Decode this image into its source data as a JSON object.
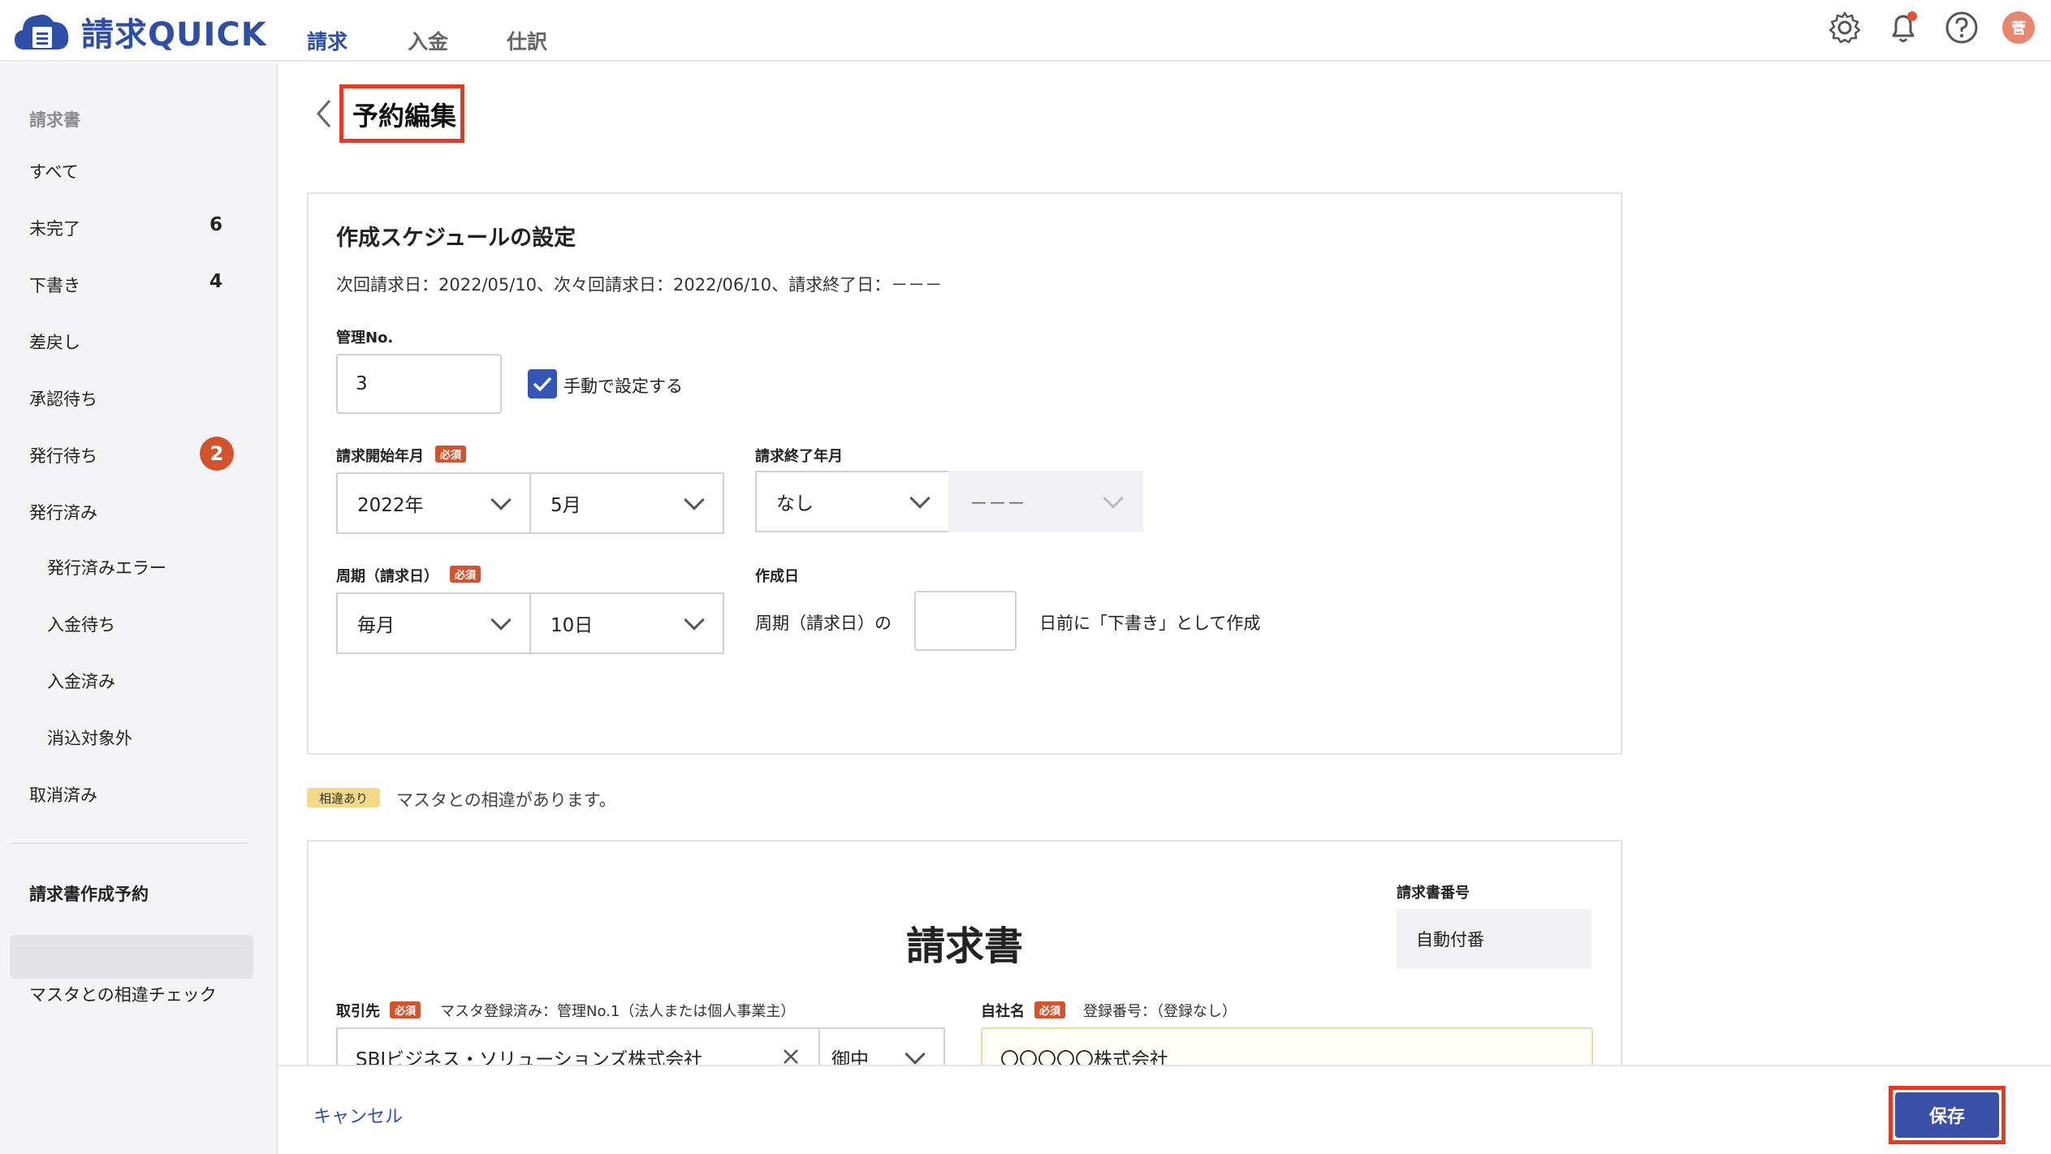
{
  "app": {
    "name": "請求QUICK"
  },
  "header": {
    "tabs": [
      "請求",
      "入金",
      "仕訳"
    ],
    "avatar_initial": "菅"
  },
  "sidebar": {
    "section_heading": "請求書",
    "items": [
      {
        "label": "すべて"
      },
      {
        "label": "未完了",
        "count": "6"
      },
      {
        "label": "下書き",
        "count": "4"
      },
      {
        "label": "差戻し"
      },
      {
        "label": "承認待ち"
      },
      {
        "label": "発行待ち",
        "badge": "2"
      },
      {
        "label": "発行済み"
      },
      {
        "label": "発行済みエラー"
      },
      {
        "label": "入金待ち"
      },
      {
        "label": "入金済み"
      },
      {
        "label": "消込対象外"
      },
      {
        "label": "取消済み"
      },
      {
        "label": "請求書作成予約"
      },
      {
        "label": "マスタとの相違チェック"
      }
    ]
  },
  "page": {
    "title": "予約編集"
  },
  "schedule": {
    "section_title": "作成スケジュールの設定",
    "info": "次回請求日：2022/05/10、次々回請求日：2022/06/10、請求終了日：－－－",
    "mgmt_no_label": "管理No.",
    "mgmt_no_value": "3",
    "manual_label": "手動で設定する",
    "start_label": "請求開始年月",
    "required": "必須",
    "start_year": "2022年",
    "start_month": "5月",
    "end_label": "請求終了年月",
    "end_value": "なし",
    "end_disabled_value": "－－－",
    "cycle_label": "周期（請求日）",
    "cycle_value": "毎月",
    "cycle_day": "10日",
    "create_label": "作成日",
    "create_prefix": "周期（請求日）の",
    "create_days_value": "",
    "create_suffix": "日前に「下書き」として作成"
  },
  "diff_notice": {
    "tag": "相違あり",
    "text": "マスタとの相違があります。"
  },
  "invoice": {
    "title": "請求書",
    "number_label": "請求書番号",
    "number_value": "自動付番",
    "client_label": "取引先",
    "client_note": "マスタ登録済み：管理No.1（法人または個人事業主）",
    "client_value": "SBIビジネス・ソリューションズ株式会社",
    "honorific": "御中",
    "own_label": "自社名",
    "own_note": "登録番号：（登録なし）",
    "own_value": "〇〇〇〇〇株式会社"
  },
  "footer": {
    "cancel": "キャンセル",
    "save": "保存"
  }
}
